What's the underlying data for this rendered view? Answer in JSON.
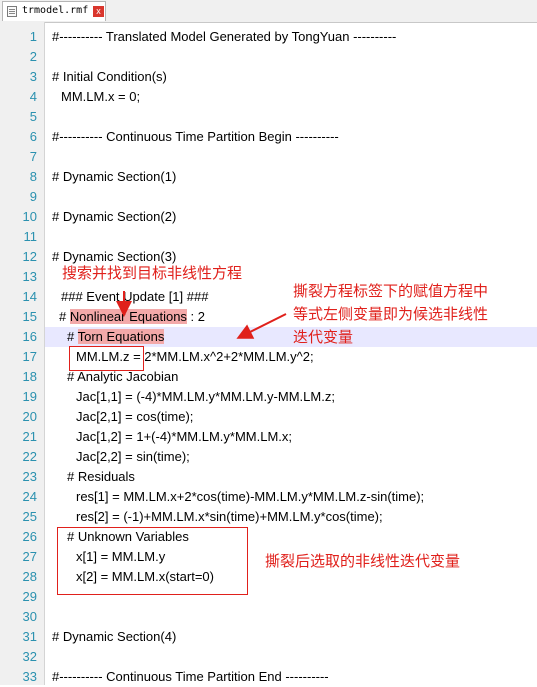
{
  "tab": {
    "label": "trmodel.rmf",
    "close_glyph": "x"
  },
  "line_numbers": [
    "1",
    "2",
    "3",
    "4",
    "5",
    "6",
    "7",
    "8",
    "9",
    "10",
    "11",
    "12",
    "13",
    "14",
    "15",
    "16",
    "17",
    "18",
    "19",
    "20",
    "21",
    "22",
    "23",
    "24",
    "25",
    "26",
    "27",
    "28",
    "29",
    "30",
    "31",
    "32",
    "33"
  ],
  "code": {
    "l1": "#---------- Translated Model Generated by TongYuan ----------",
    "l3": "# Initial Condition(s)",
    "l4": "MM.LM.x = 0;",
    "l6": "#---------- Continuous Time Partition Begin ----------",
    "l8": "# Dynamic Section(1)",
    "l10": "# Dynamic Section(2)",
    "l12": "# Dynamic Section(3)",
    "l14": "### Event Update [1] ###",
    "l15_prefix": "# ",
    "l15_mark": "Nonlinear Equations",
    "l15_suffix": " : 2",
    "l16_prefix": "# ",
    "l16_mark": "Torn Equations",
    "l17_var": "MM.LM.z",
    "l17_rest": " = 2*MM.LM.x^2+2*MM.LM.y^2;",
    "l18": "# Analytic Jacobian",
    "l19": "Jac[1,1] = (-4)*MM.LM.y*MM.LM.y-MM.LM.z;",
    "l20": "Jac[2,1] = cos(time);",
    "l21": "Jac[1,2] = 1+(-4)*MM.LM.y*MM.LM.x;",
    "l22": "Jac[2,2] = sin(time);",
    "l23": "# Residuals",
    "l24": "res[1] = MM.LM.x+2*cos(time)-MM.LM.y*MM.LM.z-sin(time);",
    "l25": "res[2] = (-1)+MM.LM.x*sin(time)+MM.LM.y*cos(time);",
    "l26": "# Unknown Variables",
    "l27": "x[1] = MM.LM.y",
    "l28": "x[2] = MM.LM.x(start=0)",
    "l31": "# Dynamic Section(4)",
    "l33": "#---------- Continuous Time Partition End ----------"
  },
  "annotations": {
    "search": "搜索并找到目标非线性方程",
    "torn_line1": "撕裂方程标签下的赋值方程中",
    "torn_line2": "等式左侧变量即为候选非线性",
    "torn_line3": "迭代变量",
    "selected": "撕裂后选取的非线性迭代变量"
  },
  "colors": {
    "line_number": "#2b91af",
    "annotation_red": "#e0201b",
    "search_highlight": "#f3a9a9",
    "current_line": "#e8e8ff"
  }
}
